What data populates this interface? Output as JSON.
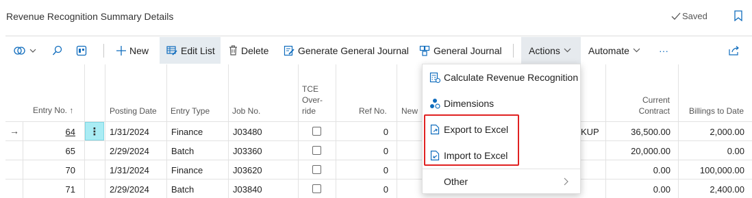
{
  "header": {
    "title": "Revenue Recognition Summary Details",
    "saved_label": "Saved"
  },
  "toolbar": {
    "new_label": "New",
    "edit_list_label": "Edit List",
    "delete_label": "Delete",
    "generate_journal_label": "Generate General Journal",
    "general_journal_label": "General Journal",
    "actions_label": "Actions",
    "automate_label": "Automate",
    "more_label": "···"
  },
  "columns": {
    "entry_no": "Entry No.",
    "entry_no_sort": "↑",
    "posting_date": "Posting Date",
    "entry_type": "Entry Type",
    "job_no": "Job No.",
    "tce_line1": "TCE",
    "tce_line2": "Over-",
    "tce_line3": "ride",
    "ref_no": "Ref No.",
    "new_partial": "New",
    "current_contract_line1": "Current",
    "current_contract_line2": "Contract",
    "billings_to_date": "Billings to Date"
  },
  "rows": [
    {
      "entry_no": "64",
      "posting_date": "1/31/2024",
      "entry_type": "Finance",
      "job_no": "J03480",
      "ref_no": "0",
      "extra": "KUP",
      "current_contract": "36,500.00",
      "billings": "2,000.00"
    },
    {
      "entry_no": "65",
      "posting_date": "2/29/2024",
      "entry_type": "Batch",
      "job_no": "J03360",
      "ref_no": "0",
      "extra": "",
      "current_contract": "20,000.00",
      "billings": "0.00"
    },
    {
      "entry_no": "70",
      "posting_date": "1/31/2024",
      "entry_type": "Finance",
      "job_no": "J03620",
      "ref_no": "0",
      "extra": "",
      "current_contract": "0.00",
      "billings": "100,000.00"
    },
    {
      "entry_no": "71",
      "posting_date": "2/29/2024",
      "entry_type": "Batch",
      "job_no": "J03840",
      "ref_no": "0",
      "extra": "",
      "current_contract": "0.00",
      "billings": "2,400.00"
    }
  ],
  "row_menu_glyph": "⋮",
  "current_row_glyph": "→",
  "actions_menu": {
    "items": [
      {
        "label": "Calculate Revenue Recognition",
        "icon": "calculate-icon"
      },
      {
        "label": "Dimensions",
        "icon": "dimensions-icon"
      },
      {
        "label": "Export to Excel",
        "icon": "excel-export-icon"
      },
      {
        "label": "Import to Excel",
        "icon": "excel-import-icon"
      },
      {
        "label": "Other",
        "icon": "chevron-right-icon"
      }
    ]
  },
  "colors": {
    "accent": "#0f6cbd",
    "highlight_border": "#e02020",
    "selected_cell": "#a9ecf4"
  }
}
